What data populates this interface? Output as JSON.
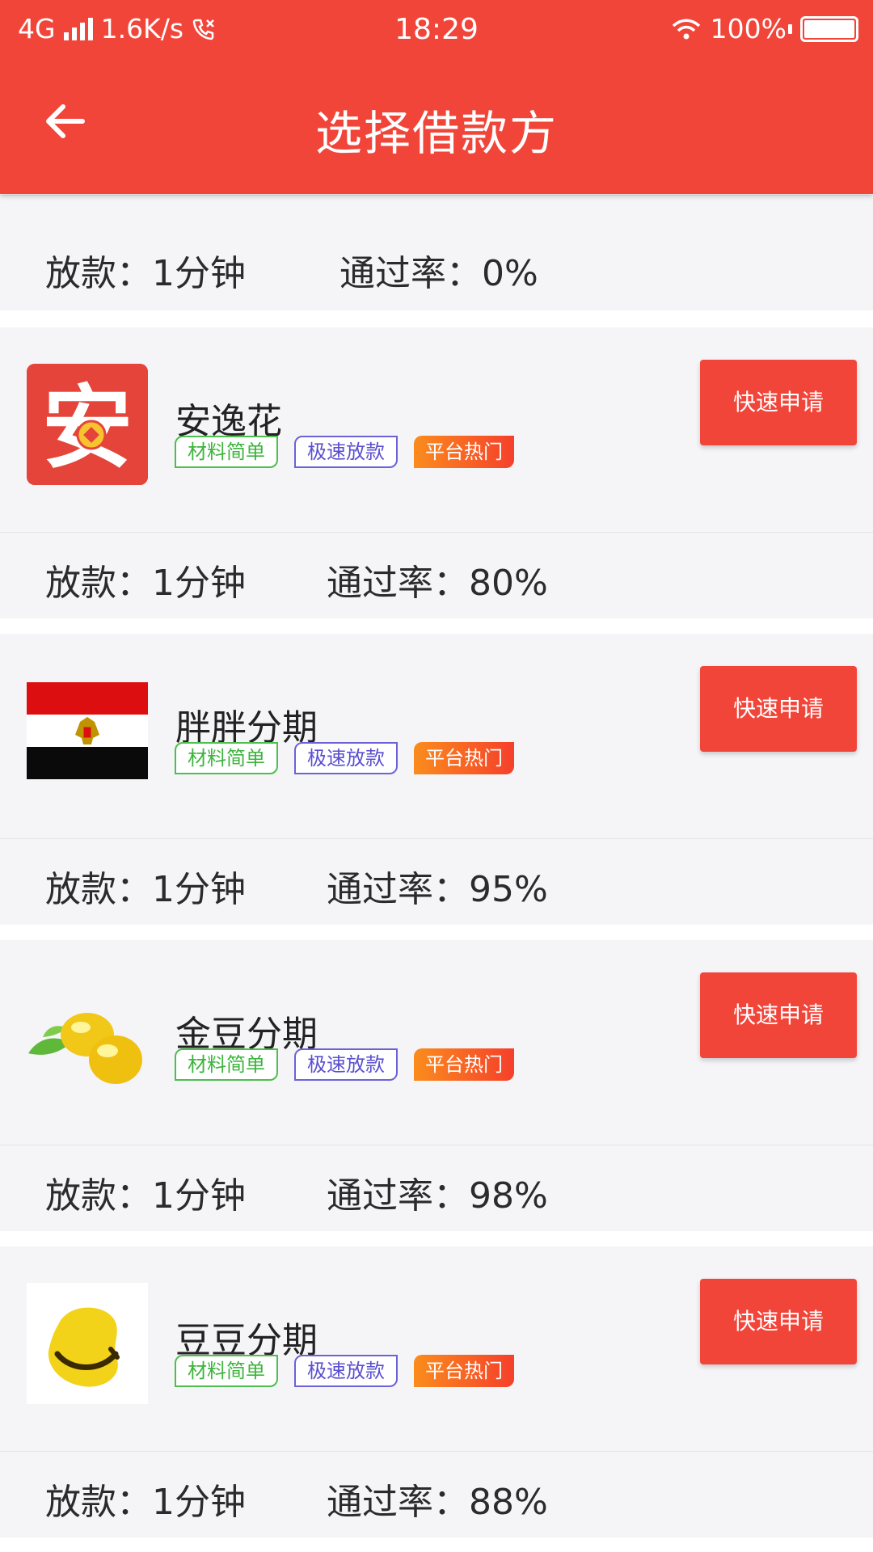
{
  "status_bar": {
    "network": "4G",
    "speed": "1.6K/s",
    "time": "18:29",
    "battery": "100%"
  },
  "header": {
    "title": "选择借款方"
  },
  "labels": {
    "loan_prefix": "放款：",
    "rate_prefix": "通过率："
  },
  "top_strip": {
    "loan_time": "1分钟",
    "pass_rate": "0%"
  },
  "products": [
    {
      "name": "安逸花",
      "logo": "an-logo",
      "tags": [
        "材料简单",
        "极速放款",
        "平台热门"
      ],
      "apply_label": "快速申请",
      "loan_time": "1分钟",
      "pass_rate": "80%",
      "logo_char": "安"
    },
    {
      "name": "胖胖分期",
      "logo": "egypt-flag-logo",
      "tags": [
        "材料简单",
        "极速放款",
        "平台热门"
      ],
      "apply_label": "快速申请",
      "loan_time": "1分钟",
      "pass_rate": "95%"
    },
    {
      "name": "金豆分期",
      "logo": "golden-beans-logo",
      "tags": [
        "材料简单",
        "极速放款",
        "平台热门"
      ],
      "apply_label": "快速申请",
      "loan_time": "1分钟",
      "pass_rate": "98%"
    },
    {
      "name": "豆豆分期",
      "logo": "smiling-bean-logo",
      "tags": [
        "材料简单",
        "极速放款",
        "平台热门"
      ],
      "apply_label": "快速申请",
      "loan_time": "1分钟",
      "pass_rate": "88%"
    }
  ],
  "colors": {
    "brand_red": "#f2453a",
    "tag_green": "#3cb43c",
    "tag_blue": "#5a4fcf",
    "tag_orange": "#fb8c1d"
  }
}
